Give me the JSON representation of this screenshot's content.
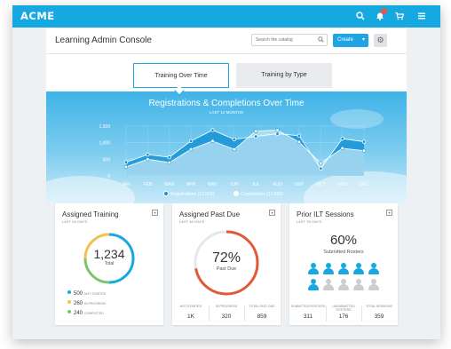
{
  "app": {
    "logo": "ACME",
    "topbar_icons": [
      "search-icon",
      "bell-icon",
      "cart-icon",
      "menu-icon"
    ],
    "accent_color": "#16a9e1"
  },
  "header": {
    "title": "Learning Admin Console",
    "search_placeholder": "Search the catalog",
    "create_label": "Create"
  },
  "tabs": [
    {
      "label": "Training Over Time",
      "active": true
    },
    {
      "label": "Training by Type",
      "active": false
    }
  ],
  "chart_data": {
    "type": "area",
    "title": "Registrations & Completions Over Time",
    "subtitle": "LAST 12 MONTHS",
    "categories": [
      "JAN",
      "FEB",
      "MAR",
      "APR",
      "MAY",
      "JUN",
      "JUL",
      "AUG",
      "SEP",
      "OCT",
      "NOV",
      "DEC"
    ],
    "yticks": [
      "1,500",
      "1,000",
      "500",
      "0"
    ],
    "ylim": [
      0,
      1500
    ],
    "series": [
      {
        "name": "Registrations",
        "total": "13,000",
        "color": "#1593d6",
        "values": [
          410,
          640,
          560,
          1050,
          1380,
          1100,
          1190,
          1270,
          1210,
          220,
          1120,
          1030
        ]
      },
      {
        "name": "Completions",
        "total": "13,000",
        "color": "#ffffff",
        "values": [
          270,
          500,
          400,
          800,
          1050,
          800,
          1350,
          1380,
          1020,
          380,
          830,
          760
        ]
      }
    ],
    "legend": [
      {
        "label": "Registrations (13,000)"
      },
      {
        "label": "Completions (13,000)"
      }
    ]
  },
  "cards": {
    "assigned": {
      "title": "Assigned Training",
      "sub": "LAST 60 DAYS",
      "total": "1,234",
      "total_label": "Total",
      "items": [
        {
          "value": "500",
          "label": "NOT STARTED",
          "color": "#16a9e1"
        },
        {
          "value": "260",
          "label": "IN PROGRESS",
          "color": "#f2c14e"
        },
        {
          "value": "240",
          "label": "COMPLETED",
          "color": "#7cc46a"
        }
      ]
    },
    "pastdue": {
      "title": "Assigned Past Due",
      "sub": "LAST 60 DAYS",
      "percent": "72%",
      "percent_value": 72,
      "percent_label": "Past Due",
      "ring_color": "#e05a3a",
      "stats": [
        {
          "label": "NOT STARTED",
          "value": "1K"
        },
        {
          "label": "IN PROGRESS",
          "value": "320"
        },
        {
          "label": "TOTAL PAST DUE",
          "value": "859"
        }
      ]
    },
    "ilt": {
      "title": "Prior ILT Sessions",
      "sub": "LAST 30 DAYS",
      "percent": "60%",
      "percent_label": "Submitted Rosters",
      "filled_people": 6,
      "total_people": 10,
      "stats": [
        {
          "label": "SUBMITTED ROSTERS",
          "value": "311"
        },
        {
          "label": "UNSUBMITTED ROSTERS",
          "value": "176"
        },
        {
          "label": "TOTAL SESSIONS",
          "value": "359"
        }
      ]
    }
  }
}
